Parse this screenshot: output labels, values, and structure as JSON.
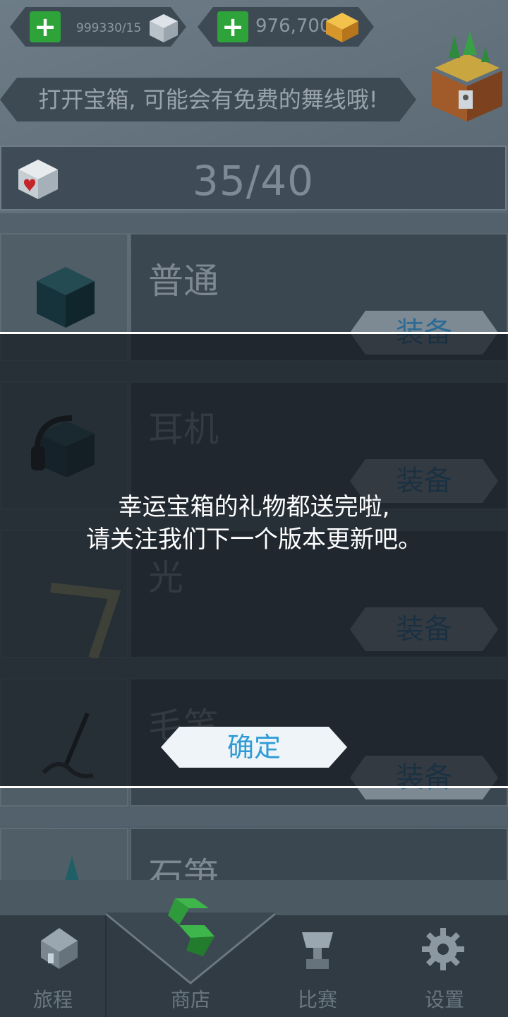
{
  "currency": {
    "cubes_value": "999330/15",
    "coins_value": "976,700"
  },
  "banner": {
    "text": "打开宝箱, 可能会有免费的舞线哦!"
  },
  "counter": {
    "value": "35/40"
  },
  "items": [
    {
      "name": "普通",
      "equip_label": "装备"
    },
    {
      "name": "耳机",
      "equip_label": "装备"
    },
    {
      "name": "光",
      "equip_label": "装备"
    },
    {
      "name": "毛笔",
      "equip_label": "装备"
    },
    {
      "name": "石笋",
      "equip_label": ""
    }
  ],
  "dialog": {
    "line1": "幸运宝箱的礼物都送完啦,",
    "line2": "请关注我们下一个版本更新吧。",
    "ok_label": "确定"
  },
  "nav": {
    "tabs": [
      {
        "label": "旅程",
        "icon": "house-icon"
      },
      {
        "label": "商店",
        "icon": "shop-icon"
      },
      {
        "label": "比赛",
        "icon": "trophy-icon"
      },
      {
        "label": "设置",
        "icon": "gear-icon"
      }
    ]
  },
  "colors": {
    "accent_blue": "#2f9bd6",
    "green_plus": "#2ea33a",
    "gold": "#e0a532"
  }
}
